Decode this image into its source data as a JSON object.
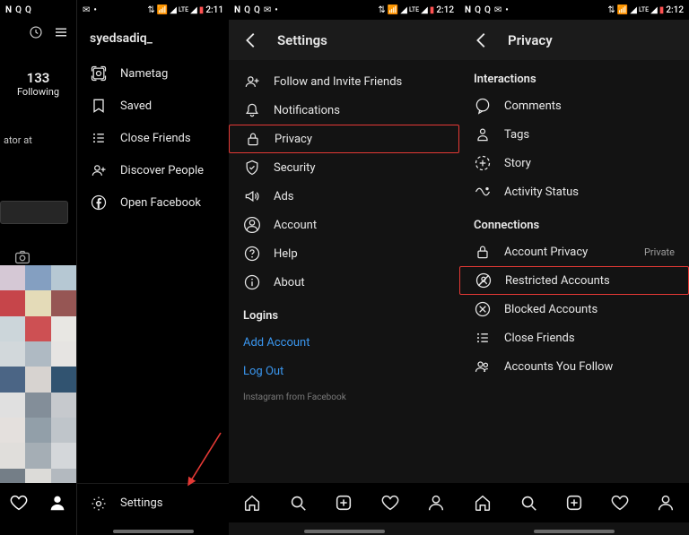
{
  "status": {
    "left_icons": [
      "N",
      "Q",
      "Q",
      "✉",
      "•"
    ],
    "right_icons": [
      "⇅",
      "📶",
      "◢",
      "LTE",
      "◢",
      "🔋"
    ],
    "time_p1": "2:11",
    "time_p3": "2:12",
    "time_p4": "2:12"
  },
  "panel1": {
    "stat_num": "133",
    "stat_label": "Following",
    "ator": "ator at",
    "bottom": {
      "heart": "",
      "person": ""
    }
  },
  "panel2": {
    "username": "syedsadiq_",
    "items": [
      {
        "icon": "nametag",
        "label": "Nametag"
      },
      {
        "icon": "bookmark",
        "label": "Saved"
      },
      {
        "icon": "list",
        "label": "Close Friends"
      },
      {
        "icon": "adduser",
        "label": "Discover People"
      },
      {
        "icon": "facebook",
        "label": "Open Facebook"
      }
    ],
    "footer": {
      "icon": "gear",
      "label": "Settings"
    }
  },
  "panel3": {
    "title": "Settings",
    "items": [
      {
        "icon": "adduser",
        "label": "Follow and Invite Friends"
      },
      {
        "icon": "bell",
        "label": "Notifications"
      },
      {
        "icon": "lock",
        "label": "Privacy",
        "highlight": true
      },
      {
        "icon": "shield",
        "label": "Security"
      },
      {
        "icon": "ads",
        "label": "Ads"
      },
      {
        "icon": "account",
        "label": "Account"
      },
      {
        "icon": "help",
        "label": "Help"
      },
      {
        "icon": "info",
        "label": "About"
      }
    ],
    "section2": "Logins",
    "links": [
      {
        "label": "Add Account"
      },
      {
        "label": "Log Out"
      }
    ],
    "footnote": "Instagram from Facebook"
  },
  "panel4": {
    "title": "Privacy",
    "sectionA": "Interactions",
    "itemsA": [
      {
        "icon": "comment",
        "label": "Comments"
      },
      {
        "icon": "tag",
        "label": "Tags"
      },
      {
        "icon": "story",
        "label": "Story"
      },
      {
        "icon": "activity",
        "label": "Activity Status"
      }
    ],
    "sectionB": "Connections",
    "itemsB": [
      {
        "icon": "lock",
        "label": "Account Privacy",
        "right": "Private"
      },
      {
        "icon": "restrict",
        "label": "Restricted Accounts",
        "highlight": true
      },
      {
        "icon": "block",
        "label": "Blocked Accounts"
      },
      {
        "icon": "list",
        "label": "Close Friends"
      },
      {
        "icon": "follow",
        "label": "Accounts You Follow"
      }
    ]
  },
  "bnav": [
    "home",
    "search",
    "add",
    "heart",
    "person"
  ]
}
